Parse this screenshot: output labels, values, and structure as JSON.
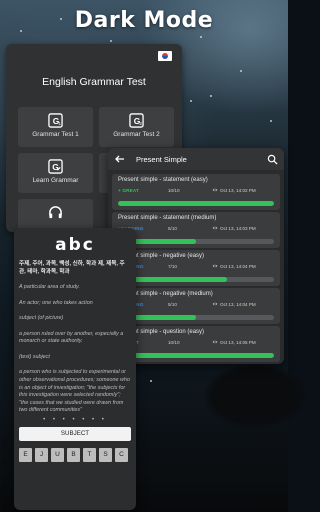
{
  "headline": "Dark Mode",
  "main_menu": {
    "title": "English Grammar Test",
    "tiles": [
      {
        "label": "Grammar Test 1",
        "icon": "g1-icon",
        "glyph": "G1"
      },
      {
        "label": "Grammar Test 2",
        "icon": "g2-icon",
        "glyph": "G2"
      },
      {
        "label": "Learn Grammar",
        "icon": "learn-icon",
        "glyph": "G"
      },
      {
        "label": "",
        "icon": "headphones-icon",
        "glyph": ""
      }
    ]
  },
  "list": {
    "title": "Present Simple",
    "items": [
      {
        "name": "Present simple - statement (easy)",
        "status": "+ GREAT",
        "status_color": "#33c25a",
        "score": "10/10",
        "date": "Oct 13, 14:02 PM",
        "progress": 1.0
      },
      {
        "name": "Present simple - statement (medium)",
        "status": "LEARNING",
        "status_color": "#3a8ee6",
        "score": "5/10",
        "date": "Oct 13, 14:03 PM",
        "progress": 0.5
      },
      {
        "name": "Present simple - negative (easy)",
        "status": "LEARNING",
        "status_color": "#3a8ee6",
        "score": "7/10",
        "date": "Oct 13, 14:04 PM",
        "progress": 0.7
      },
      {
        "name": "Present simple - negative (medium)",
        "status": "LEARNING",
        "status_color": "#3a8ee6",
        "score": "5/10",
        "date": "Oct 13, 14:04 PM",
        "progress": 0.5
      },
      {
        "name": "Present simple - question (easy)",
        "status": "+ GREAT",
        "status_color": "#33c25a",
        "score": "10/10",
        "date": "Oct 13, 14:05 PM",
        "progress": 1.0
      }
    ]
  },
  "card": {
    "title": "abc",
    "korean": "주제, 주어, 과목, 백성, 신하, 학과 제, 제목, 주관, 테마, 학과목, 학과",
    "definitions": [
      "A particular area of study.",
      "An actor; one who takes action",
      "subject (of picture)",
      "a person ruled over by another, especially a monarch or state authority.",
      "(test) subject",
      "a person who is subjected to experimental or other observational procedures; someone who is an object of investigation; \"the subjects for this investigation were selected randomly\"; \"the cases that we studied were drawn from two different communities\""
    ],
    "dots": "• • • • • • •",
    "answer": "SUBJECT",
    "keys": [
      "E",
      "J",
      "U",
      "B",
      "T",
      "S",
      "C"
    ]
  }
}
